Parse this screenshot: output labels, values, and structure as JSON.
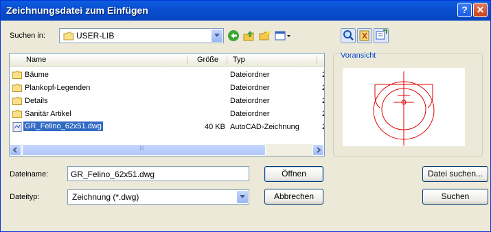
{
  "window": {
    "title": "Zeichnungsdatei zum Einfügen",
    "help_label": "?",
    "close_label": "✕"
  },
  "lookin": {
    "label": "Suchen in:",
    "value": "USER-LIB"
  },
  "list": {
    "columns": [
      "Name",
      "Größe",
      "Typ"
    ],
    "rows": [
      {
        "name": "Bäume",
        "size": "",
        "type": "Dateiordner",
        "extra": "2"
      },
      {
        "name": "Plankopf-Legenden",
        "size": "",
        "type": "Dateiordner",
        "extra": "2"
      },
      {
        "name": "Details",
        "size": "",
        "type": "Dateiordner",
        "extra": "2"
      },
      {
        "name": "Sanitär Artikel",
        "size": "",
        "type": "Dateiordner",
        "extra": "2"
      },
      {
        "name": "GR_Felino_62x51.dwg",
        "size": "40 KB",
        "type": "AutoCAD-Zeichnung",
        "extra": "2"
      }
    ],
    "scroll_grip": "III"
  },
  "preview": {
    "label": "Voransicht"
  },
  "filename": {
    "label": "Dateiname:",
    "value": "GR_Felino_62x51.dwg"
  },
  "filetype": {
    "label": "Dateityp:",
    "value": "Zeichnung (*.dwg)"
  },
  "buttons": {
    "open": "Öffnen",
    "cancel": "Abbrechen",
    "find_file": "Datei suchen...",
    "search": "Suchen"
  },
  "colors": {
    "title_bar": "#0a50d4",
    "selection": "#316ac5",
    "preview_lines": "#e00000"
  }
}
